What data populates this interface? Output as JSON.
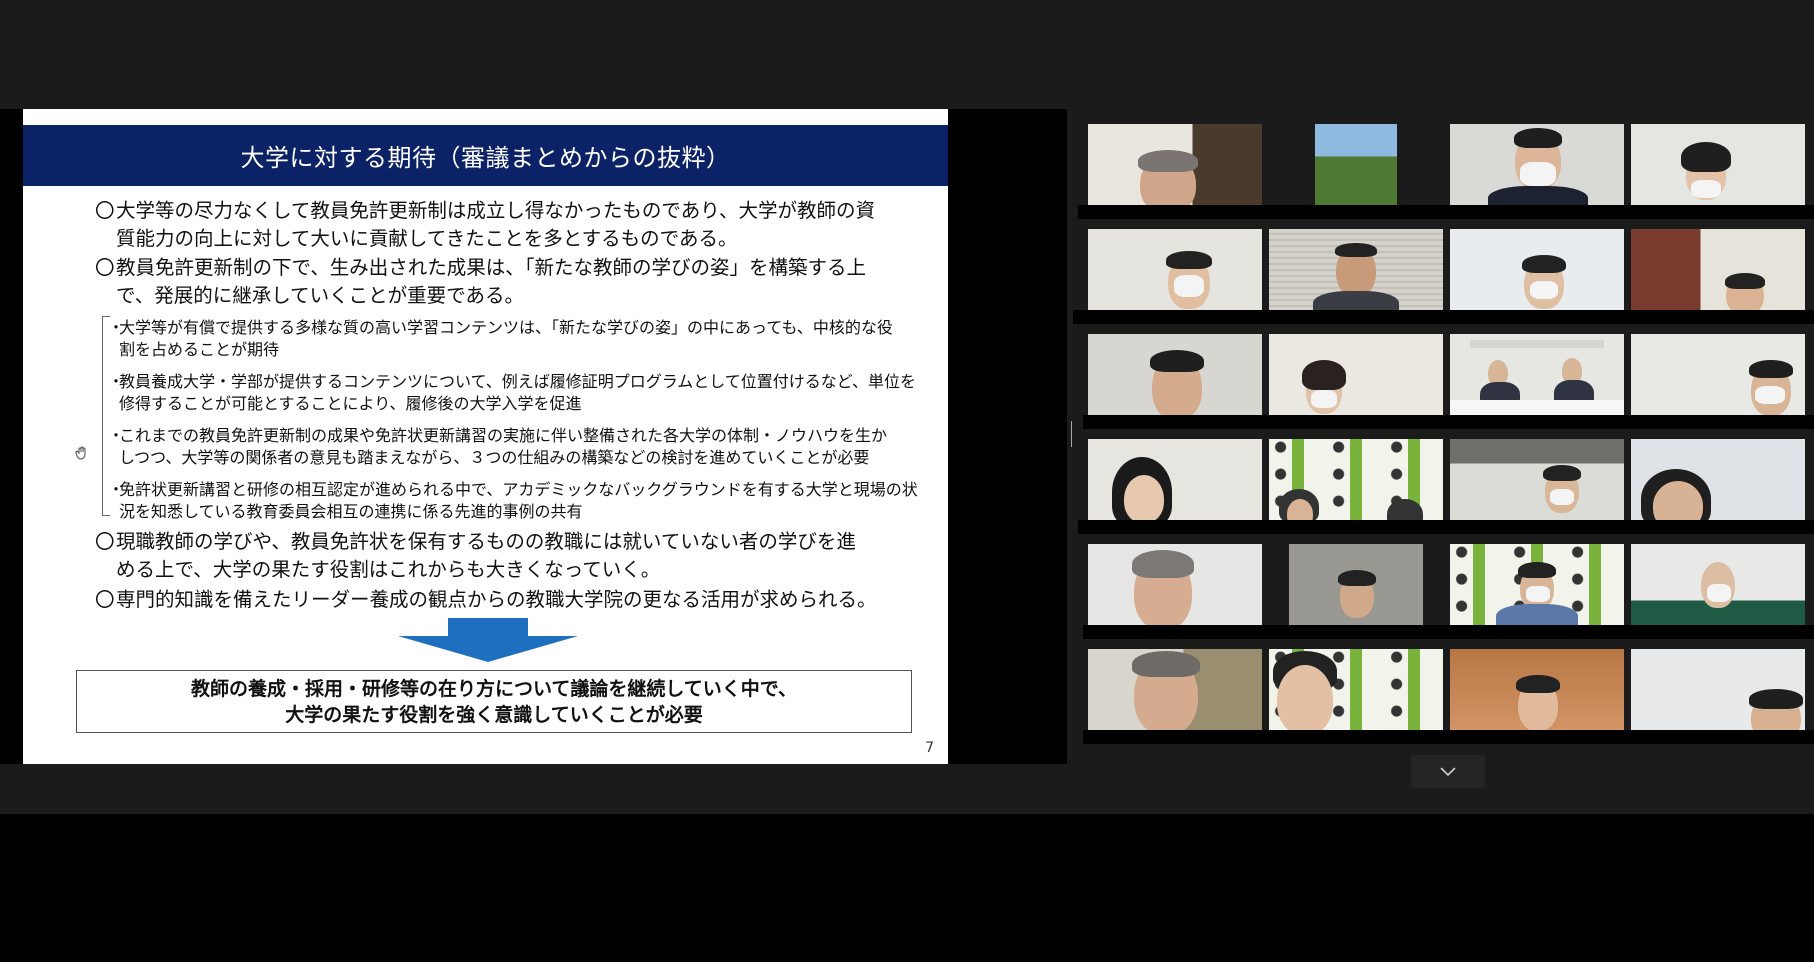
{
  "slide": {
    "title": "大学に対する期待（審議まとめからの抜粋）",
    "bullets": [
      {
        "mark": "〇",
        "lines": [
          "大学等の尽力なくして教員免許更新制は成立し得なかったものであり、大学が教師の資",
          "質能力の向上に対して大いに貢献してきたことを多とするものである。"
        ]
      },
      {
        "mark": "〇",
        "lines": [
          "教員免許更新制の下で、生み出された成果は、「新たな教師の学びの姿」を構築する上",
          "で、発展的に継承していくことが重要である。"
        ]
      }
    ],
    "subbullets": [
      {
        "mark": "・",
        "lines": [
          "大学等が有償で提供する多様な質の高い学習コンテンツは、「新たな学びの姿」の中にあっても、中核的な役",
          "割を占めることが期待"
        ]
      },
      {
        "mark": "・",
        "lines": [
          "教員養成大学・学部が提供するコンテンツについて、例えば履修証明プログラムとして位置付けるなど、単位を",
          "修得することが可能とすることにより、履修後の大学入学を促進"
        ]
      },
      {
        "mark": "・",
        "lines": [
          "これまでの教員免許更新制の成果や免許状更新講習の実施に伴い整備された各大学の体制・ノウハウを生か",
          "しつつ、大学等の関係者の意見も踏まえながら、３つの仕組みの構築などの検討を進めていくことが必要"
        ]
      },
      {
        "mark": "・",
        "lines": [
          "免許状更新講習と研修の相互認定が進められる中で、アカデミックなバックグラウンドを有する大学と現場の状",
          "況を知悉している教育委員会相互の連携に係る先進的事例の共有"
        ]
      }
    ],
    "bullets_after": [
      {
        "mark": "〇",
        "lines": [
          "現職教師の学びや、教員免許状を保有するものの教職には就いていない者の学びを進",
          "める上で、大学の果たす役割はこれからも大きくなっていく。"
        ]
      },
      {
        "mark": "〇",
        "lines": [
          "専門的知識を備えたリーダー養成の観点からの教職大学院の更なる活用が求められる。"
        ]
      }
    ],
    "conclusion": [
      "教師の養成・採用・研修等の在り方について議論を継続していく中で、",
      "大学の果たす役割を強く意識していくことが必要"
    ],
    "page_number": "7"
  },
  "colors": {
    "header_bg": "#0b2266",
    "arrow": "#1f6fc0",
    "active_speaker": "#a6d84a",
    "chrome": "#1b1b1b"
  },
  "icons": {
    "hand": "raised-hand-icon",
    "scroll": "chevron-down-icon"
  }
}
